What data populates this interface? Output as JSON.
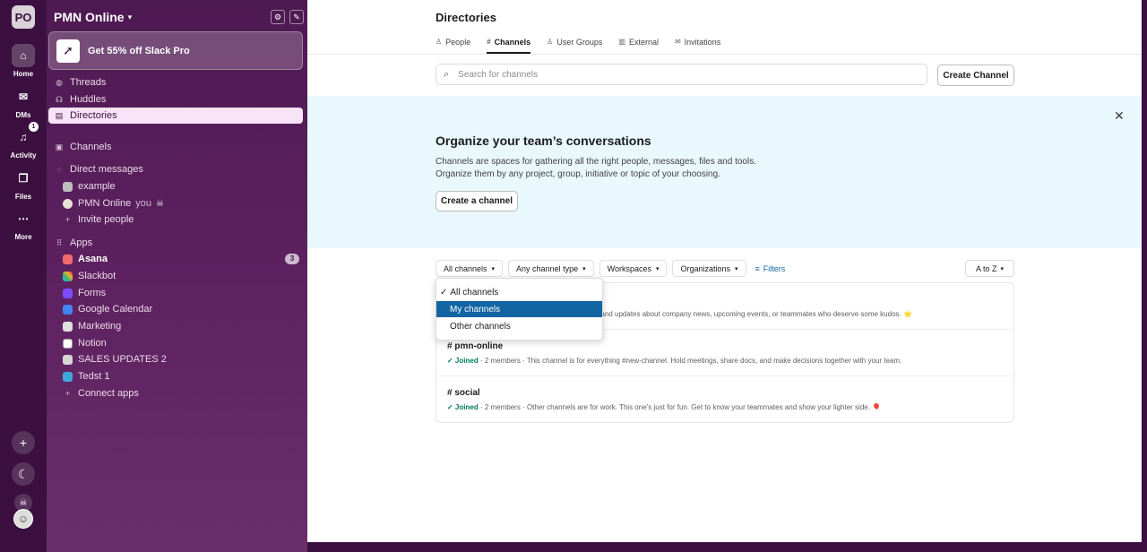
{
  "rail": {
    "workspace_initials": "PO",
    "items": [
      {
        "label": "Home",
        "icon": "home-icon",
        "glyph": "⌂"
      },
      {
        "label": "DMs",
        "icon": "dm-icon",
        "glyph": "✉"
      },
      {
        "label": "Activity",
        "icon": "bell-icon",
        "glyph": "🔔︎",
        "badge": "1"
      },
      {
        "label": "Files",
        "icon": "files-icon",
        "glyph": "❐"
      },
      {
        "label": "More",
        "icon": "more-icon",
        "glyph": "⋯"
      }
    ]
  },
  "sidebar": {
    "workspace_name": "PMN Online",
    "promo": "Get 55% off Slack Pro",
    "nav": {
      "threads": "Threads",
      "huddles": "Huddles",
      "directories": "Directories"
    },
    "channels_header": "Channels",
    "dm_header": "Direct messages",
    "dms": {
      "example": "example",
      "pmn": "PMN Online",
      "you": "you",
      "invite": "Invite people"
    },
    "apps_header": "Apps",
    "apps": {
      "asana": "Asana",
      "asana_badge": "3",
      "slackbot": "Slackbot",
      "forms": "Forms",
      "gcal": "Google Calendar",
      "marketing": "Marketing",
      "notion": "Notion",
      "sales": "SALES UPDATES 2",
      "tedst": "Tedst 1",
      "connect": "Connect apps"
    }
  },
  "main": {
    "title": "Directories",
    "tabs": {
      "people": "People",
      "channels": "Channels",
      "user_groups": "User Groups",
      "external": "External",
      "invitations": "Invitations"
    },
    "search_placeholder": "Search for channels",
    "create_channel": "Create Channel",
    "banner": {
      "title": "Organize your team’s conversations",
      "line1": "Channels are spaces for gathering all the right people, messages, files and tools.",
      "line2": "Organize them by any project, group, initiative or topic of your choosing.",
      "button": "Create a channel"
    },
    "filters": {
      "all": "All channels",
      "type": "Any channel type",
      "workspaces": "Workspaces",
      "orgs": "Organizations",
      "filters": "Filters",
      "sort": "A to Z"
    },
    "channels": [
      {
        "name": "",
        "meta": "ts and updates about company news, upcoming events, or teammates who deserve some kudos. ⭐"
      },
      {
        "name": "# pmn-online",
        "joined": "✓ Joined",
        "members": " · 2 members · ",
        "desc": "This channel is for everything #new-channel. Hold meetings, share docs, and make decisions together with your team."
      },
      {
        "name": "# social",
        "joined": "✓ Joined",
        "members": " · 2 members · ",
        "desc": "Other channels are for work. This one’s just for fun. Get to know your teammates and show your lighter side. 🎈"
      }
    ],
    "dropdown": {
      "all": "All channels",
      "mine": "My channels",
      "other": "Other channels"
    }
  }
}
